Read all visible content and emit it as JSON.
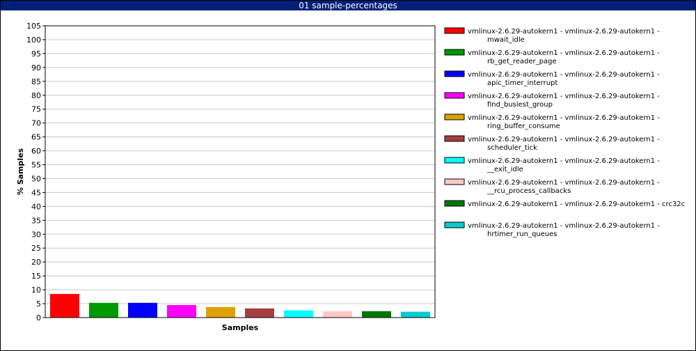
{
  "window": {
    "title": "01 sample-percentages"
  },
  "chart_data": {
    "type": "bar",
    "title": "01 sample-percentages",
    "xlabel": "Samples",
    "ylabel": "% Samples",
    "ylim": [
      0,
      105
    ],
    "yticks": [
      0,
      5,
      10,
      15,
      20,
      25,
      30,
      35,
      40,
      45,
      50,
      55,
      60,
      65,
      70,
      75,
      80,
      85,
      90,
      95,
      100,
      105
    ],
    "grid": true,
    "legend_position": "right",
    "series": [
      {
        "name": "vmlinux-2.6.29-autokern1 - vmlinux-2.6.29-autokern1 - mwait_idle",
        "lines": [
          "vmlinux-2.6.29-autokern1 - vmlinux-2.6.29-autokern1 -",
          "mwait_idle"
        ],
        "value": 8.5,
        "color": "#ff0000"
      },
      {
        "name": "vmlinux-2.6.29-autokern1 - vmlinux-2.6.29-autokern1 - rb_get_reader_page",
        "lines": [
          "vmlinux-2.6.29-autokern1 - vmlinux-2.6.29-autokern1 -",
          "rb_get_reader_page"
        ],
        "value": 5.3,
        "color": "#009900"
      },
      {
        "name": "vmlinux-2.6.29-autokern1 - vmlinux-2.6.29-autokern1 - apic_timer_interrupt",
        "lines": [
          "vmlinux-2.6.29-autokern1 - vmlinux-2.6.29-autokern1 -",
          "apic_timer_interrupt"
        ],
        "value": 5.3,
        "color": "#0000ff"
      },
      {
        "name": "vmlinux-2.6.29-autokern1 - vmlinux-2.6.29-autokern1 - find_busiest_group",
        "lines": [
          "vmlinux-2.6.29-autokern1 - vmlinux-2.6.29-autokern1 -",
          "find_busiest_group"
        ],
        "value": 4.5,
        "color": "#ff00ff"
      },
      {
        "name": "vmlinux-2.6.29-autokern1 - vmlinux-2.6.29-autokern1 - ring_buffer_consume",
        "lines": [
          "vmlinux-2.6.29-autokern1 - vmlinux-2.6.29-autokern1 -",
          "ring_buffer_consume"
        ],
        "value": 3.8,
        "color": "#e0a000"
      },
      {
        "name": "vmlinux-2.6.29-autokern1 - vmlinux-2.6.29-autokern1 - scheduler_tick",
        "lines": [
          "vmlinux-2.6.29-autokern1 - vmlinux-2.6.29-autokern1 -",
          "scheduler_tick"
        ],
        "value": 3.3,
        "color": "#a33f3f"
      },
      {
        "name": "vmlinux-2.6.29-autokern1 - vmlinux-2.6.29-autokern1 - __exit_idle",
        "lines": [
          "vmlinux-2.6.29-autokern1 - vmlinux-2.6.29-autokern1 -",
          "__exit_idle"
        ],
        "value": 2.6,
        "color": "#00ffff"
      },
      {
        "name": "vmlinux-2.6.29-autokern1 - vmlinux-2.6.29-autokern1 - __rcu_process_callbacks",
        "lines": [
          "vmlinux-2.6.29-autokern1 - vmlinux-2.6.29-autokern1 -",
          "__rcu_process_callbacks"
        ],
        "value": 2.3,
        "color": "#ffc8c8"
      },
      {
        "name": "vmlinux-2.6.29-autokern1 - vmlinux-2.6.29-autokern1 - crc32c",
        "lines": [
          "vmlinux-2.6.29-autokern1 - vmlinux-2.6.29-autokern1 - crc32c"
        ],
        "value": 2.3,
        "color": "#007700"
      },
      {
        "name": "vmlinux-2.6.29-autokern1 - vmlinux-2.6.29-autokern1 - hrtimer_run_queues",
        "lines": [
          "vmlinux-2.6.29-autokern1 - vmlinux-2.6.29-autokern1 -",
          "hrtimer_run_queues"
        ],
        "value": 2.1,
        "color": "#00cccc"
      }
    ]
  }
}
